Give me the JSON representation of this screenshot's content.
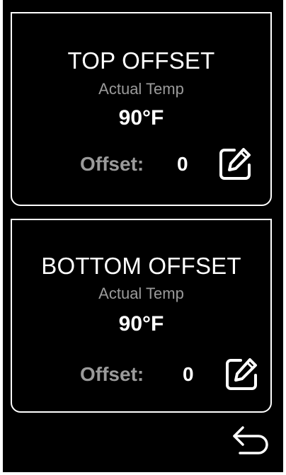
{
  "cards": [
    {
      "title": "TOP OFFSET",
      "subtitle": "Actual Temp",
      "temperature": "90°F",
      "offset_label": "Offset:",
      "offset_value": "0",
      "edit_icon": "edit-icon"
    },
    {
      "title": "BOTTOM OFFSET",
      "subtitle": "Actual Temp",
      "temperature": "90°F",
      "offset_label": "Offset:",
      "offset_value": "0",
      "edit_icon": "edit-icon"
    }
  ],
  "footer": {
    "back_icon": "back-arrow-icon"
  },
  "colors": {
    "background": "#000000",
    "text_primary": "#ffffff",
    "text_secondary": "#9a9a9a",
    "border": "#ffffff"
  }
}
